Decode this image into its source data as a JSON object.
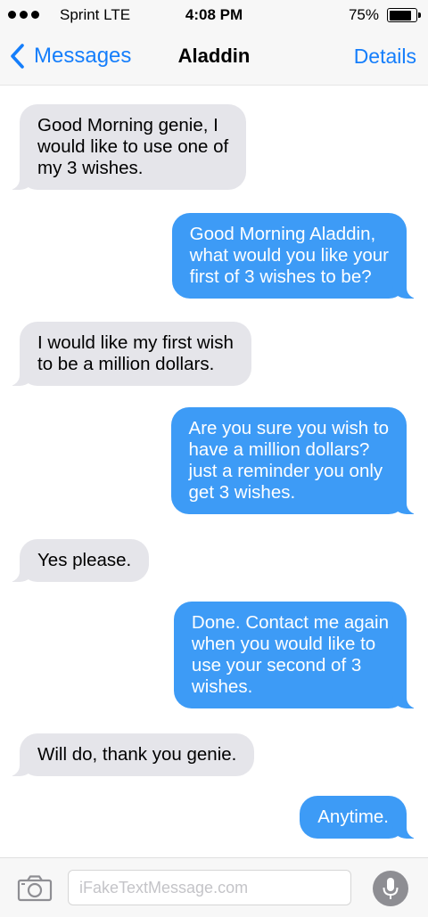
{
  "status_bar": {
    "carrier": "Sprint  LTE",
    "time": "4:08 PM",
    "battery": "75%",
    "battery_level": 0.75,
    "signal_icon": "signal-dots-icon",
    "battery_icon": "battery-icon"
  },
  "nav": {
    "back_label": "Messages",
    "back_icon": "chevron-left-icon",
    "title": "Aladdin",
    "details_label": "Details"
  },
  "messages": [
    {
      "direction": "received",
      "text": "Good Morning genie, I\nwould like to use one of\nmy 3 wishes."
    },
    {
      "direction": "sent",
      "text": "Good Morning Aladdin,\nwhat would you like your\nfirst of 3 wishes to be?"
    },
    {
      "direction": "received",
      "text": "I would like my first wish\nto be a million dollars."
    },
    {
      "direction": "sent",
      "text": "Are you sure you wish to\nhave a million dollars?\njust a reminder you only\nget 3 wishes."
    },
    {
      "direction": "received",
      "text": "Yes please."
    },
    {
      "direction": "sent",
      "text": "Done. Contact me again\nwhen you would like to\nuse your second of 3\nwishes."
    },
    {
      "direction": "received",
      "text": "Will do, thank you genie."
    },
    {
      "direction": "sent",
      "text": "Anytime."
    }
  ],
  "input_bar": {
    "placeholder": "iFakeTextMessage.com",
    "value": "",
    "camera_icon": "camera-icon",
    "mic_icon": "microphone-icon"
  },
  "colors": {
    "accent": "#157efb",
    "sent_bubble": "#3d9bf6",
    "received_bubble": "#e5e5ea",
    "bar_background": "#f7f7f7"
  }
}
